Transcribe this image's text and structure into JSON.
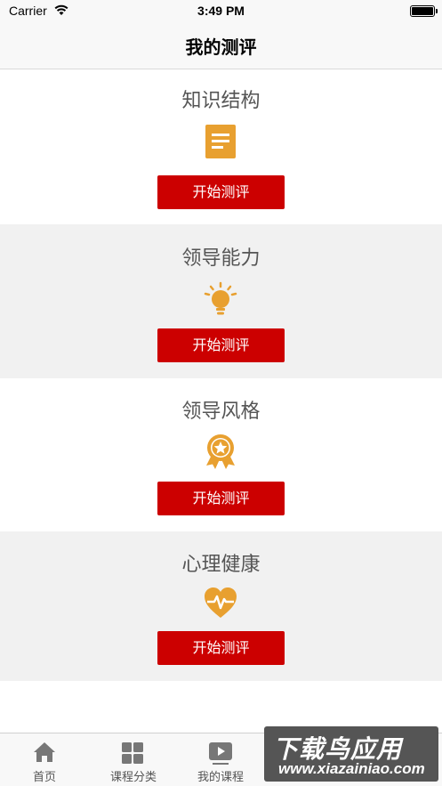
{
  "status_bar": {
    "carrier": "Carrier",
    "time": "3:49 PM"
  },
  "nav": {
    "title": "我的测评"
  },
  "sections": [
    {
      "title": "知识结构",
      "icon": "document-icon",
      "button": "开始测评"
    },
    {
      "title": "领导能力",
      "icon": "lightbulb-icon",
      "button": "开始测评"
    },
    {
      "title": "领导风格",
      "icon": "award-badge-icon",
      "button": "开始测评"
    },
    {
      "title": "心理健康",
      "icon": "heart-pulse-icon",
      "button": "开始测评"
    }
  ],
  "tab_bar": {
    "items": [
      {
        "label": "首页",
        "icon": "home-icon"
      },
      {
        "label": "课程分类",
        "icon": "grid-icon"
      },
      {
        "label": "我的课程",
        "icon": "video-play-icon"
      }
    ]
  },
  "watermark": {
    "title": "下载鸟应用",
    "url": "www.xiazainiao.com"
  },
  "colors": {
    "accent": "#cc0000",
    "icon": "#e8a030",
    "alt_bg": "#f1f1f1"
  }
}
